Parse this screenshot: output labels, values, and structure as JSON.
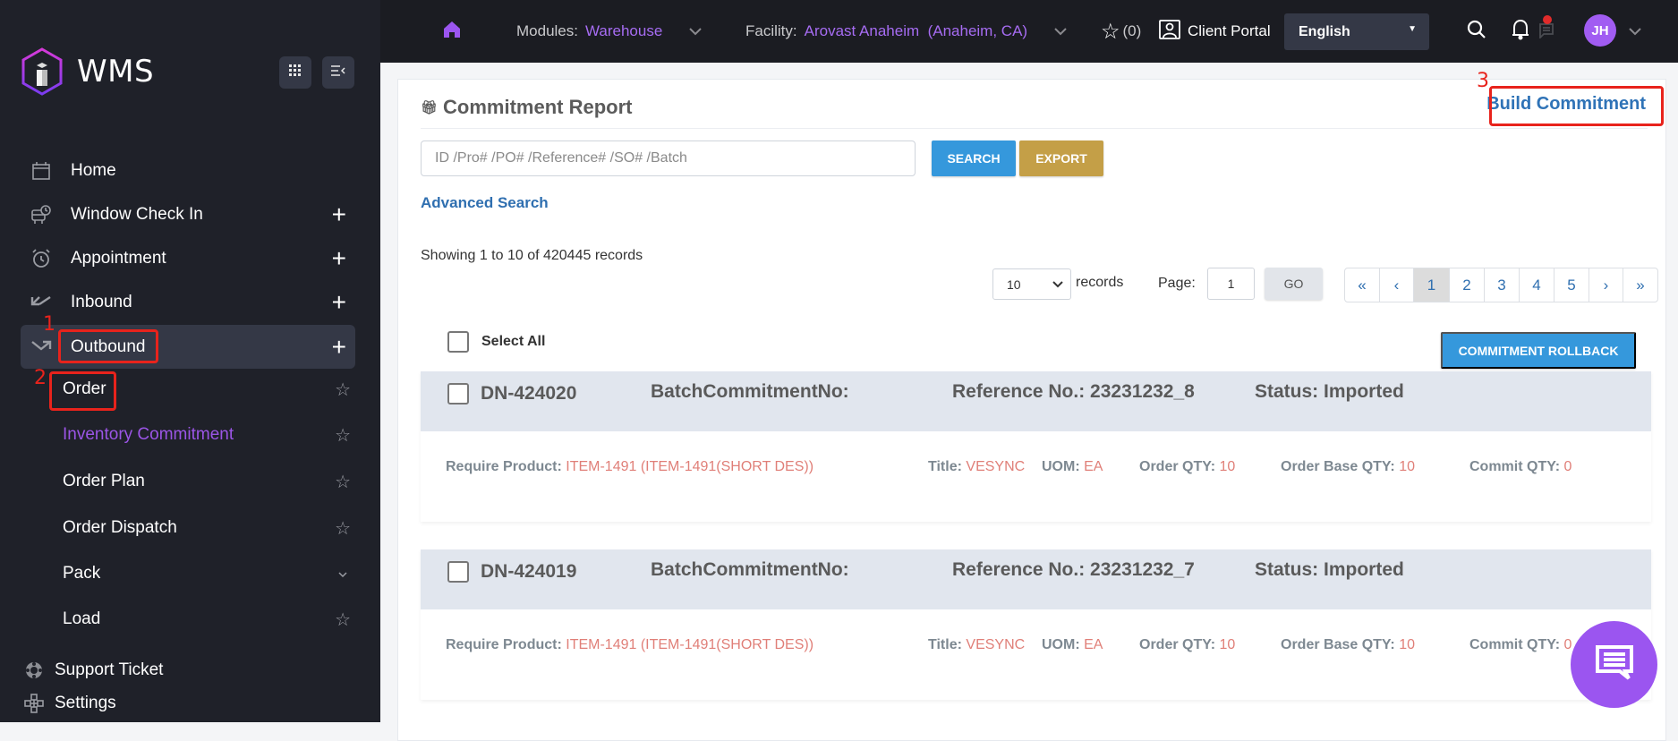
{
  "app": {
    "brand": "WMS"
  },
  "sidebar": {
    "items": [
      {
        "label": "Home",
        "icon": "calendar-icon",
        "expandable": false
      },
      {
        "label": "Window Check In",
        "icon": "truck-clock-icon",
        "expandable": true
      },
      {
        "label": "Appointment",
        "icon": "alarm-clock-icon",
        "expandable": true
      },
      {
        "label": "Inbound",
        "icon": "arrow-down-left-icon",
        "expandable": true
      },
      {
        "label": "Outbound",
        "icon": "arrow-down-right-icon",
        "expandable": true,
        "active": true
      }
    ],
    "sub_items": [
      {
        "label": "Order",
        "trailing": "star"
      },
      {
        "label": "Inventory Commitment",
        "trailing": "star",
        "current": true
      },
      {
        "label": "Order Plan",
        "trailing": "star"
      },
      {
        "label": "Order Dispatch",
        "trailing": "star"
      },
      {
        "label": "Pack",
        "trailing": "chevron"
      },
      {
        "label": "Load",
        "trailing": "star"
      }
    ],
    "bottom_items": [
      {
        "label": "Support Ticket",
        "icon": "lifebuoy-icon"
      },
      {
        "label": "Settings",
        "icon": "settings-nodes-icon"
      }
    ]
  },
  "topbar": {
    "modules_label": "Modules:",
    "modules_value": "Warehouse",
    "facility_label": "Facility:",
    "facility_value": "Arovast Anaheim  (Anaheim, CA)",
    "favorites_count": "(0)",
    "client_portal": "Client Portal",
    "language": "English",
    "avatar_initials": "JH"
  },
  "annotations": [
    {
      "number": "1",
      "target": "Outbound"
    },
    {
      "number": "2",
      "target": "Order"
    },
    {
      "number": "3",
      "target": "Build Commitment"
    }
  ],
  "main": {
    "title": "Commitment Report",
    "build_button": "Build Commitment",
    "search_placeholder": "ID /Pro# /PO# /Reference# /SO# /Batch",
    "search_value": "",
    "search_button": "SEARCH",
    "export_button": "EXPORT",
    "advanced_search": "Advanced Search",
    "showing": "Showing 1 to 10 of 420445 records",
    "per_page": "10",
    "records_label": "records",
    "page_label": "Page:",
    "page_value": "1",
    "go_button": "GO",
    "pagination": [
      "«",
      "‹",
      "1",
      "2",
      "3",
      "4",
      "5",
      "›",
      "»"
    ],
    "current_page": "1",
    "select_all": "Select All",
    "rollback_button": "COMMITMENT ROLLBACK",
    "records": [
      {
        "id": "DN-424020",
        "batch_label": "BatchCommitmentNo:",
        "batch_value": "",
        "reference": "Reference No.: 23231232_8",
        "status": "Status: Imported",
        "require_product_label": "Require Product:",
        "require_product": "ITEM-1491 (ITEM-1491(SHORT DES))",
        "title_label": "Title:",
        "title": "VESYNC",
        "uom_label": "UOM:",
        "uom": "EA",
        "order_qty_label": "Order QTY:",
        "order_qty": "10",
        "order_base_qty_label": "Order Base QTY:",
        "order_base_qty": "10",
        "commit_qty_label": "Commit QTY:",
        "commit_qty": "0"
      },
      {
        "id": "DN-424019",
        "batch_label": "BatchCommitmentNo:",
        "batch_value": "",
        "reference": "Reference No.: 23231232_7",
        "status": "Status: Imported",
        "require_product_label": "Require Product:",
        "require_product": "ITEM-1491 (ITEM-1491(SHORT DES))",
        "title_label": "Title:",
        "title": "VESYNC",
        "uom_label": "UOM:",
        "uom": "EA",
        "order_qty_label": "Order QTY:",
        "order_qty": "10",
        "order_base_qty_label": "Order Base QTY:",
        "order_base_qty": "10",
        "commit_qty_label": "Commit QTY:",
        "commit_qty": "0"
      }
    ]
  },
  "colors": {
    "accent_purple": "#a15cf2",
    "primary_blue": "#3598dc",
    "export_gold": "#c49f47",
    "link_blue": "#2f6fb0",
    "value_red": "#e07f78",
    "annotation_red": "#e8231c",
    "sidebar_bg": "#1f2129",
    "topbar_bg": "#1b1c22"
  }
}
